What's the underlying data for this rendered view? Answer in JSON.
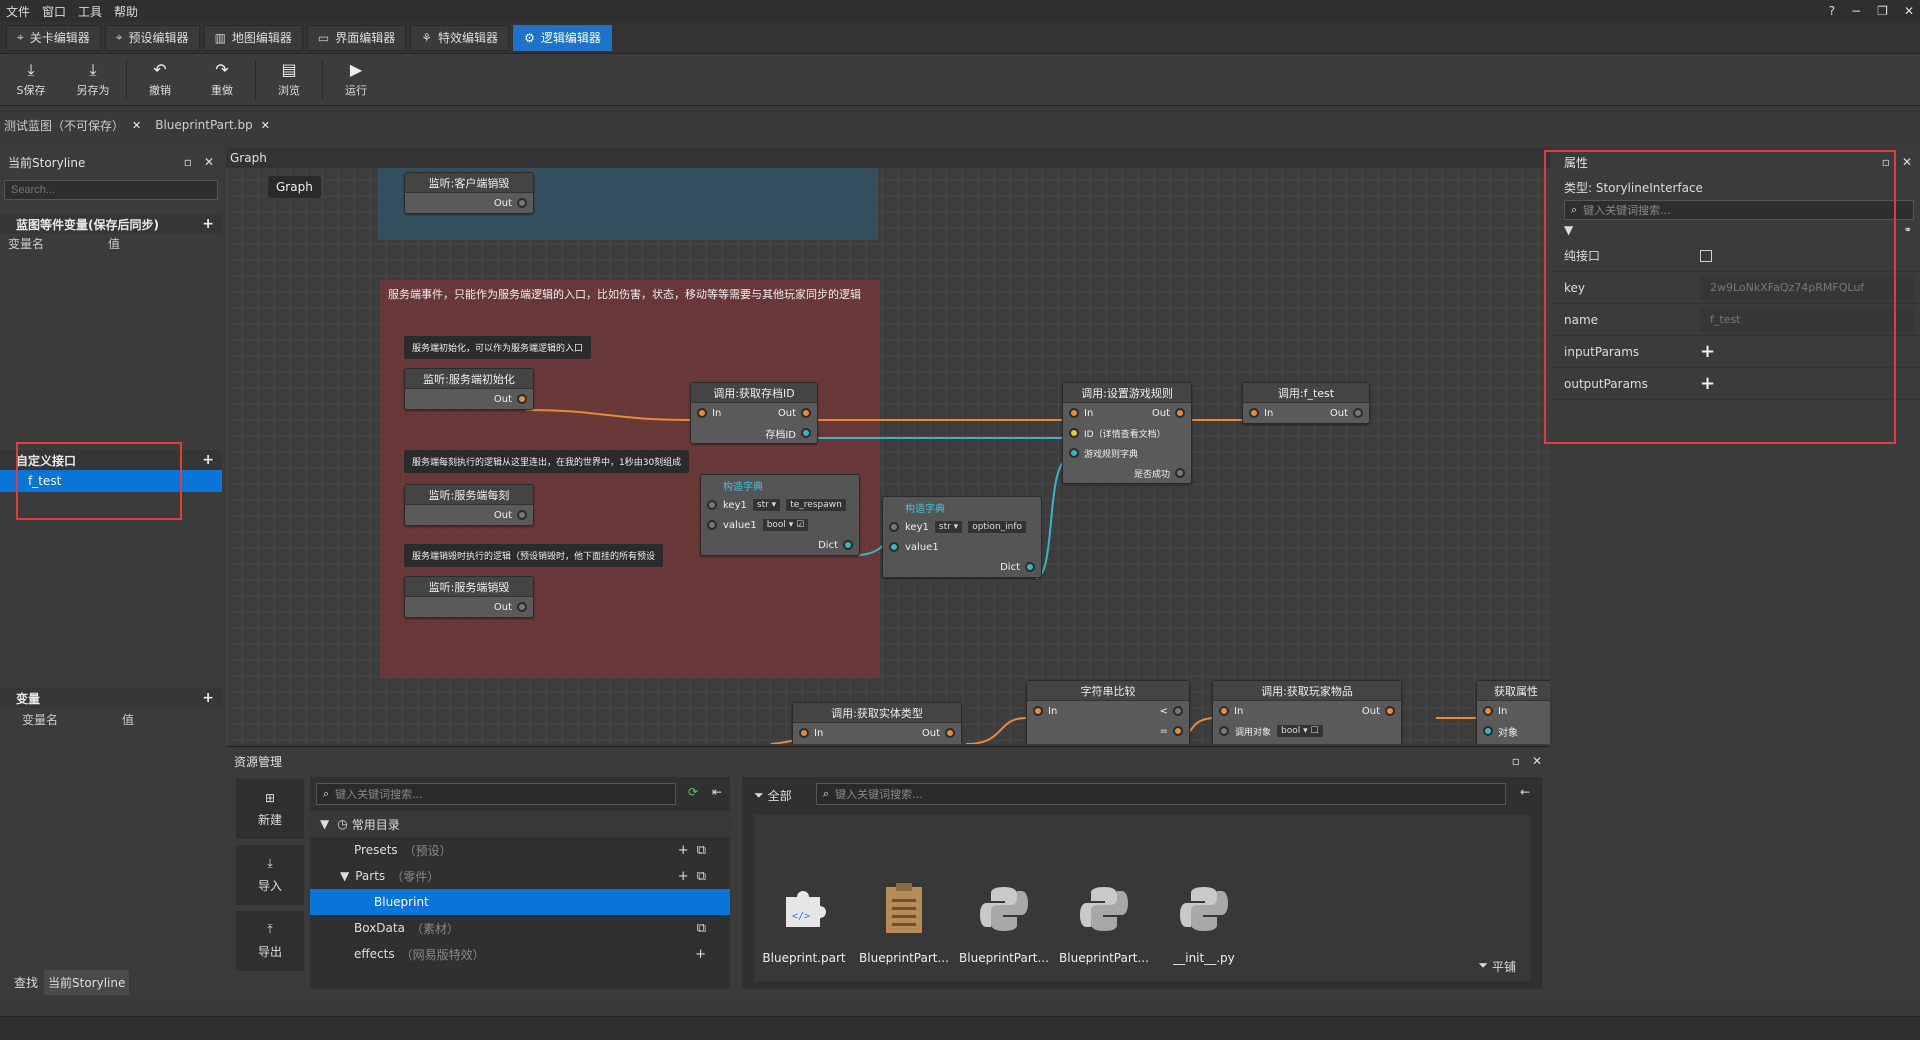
{
  "menubar": {
    "items": [
      "文件",
      "窗口",
      "工具",
      "帮助"
    ],
    "controls": [
      "?",
      "−",
      "❐",
      "✕"
    ]
  },
  "editor_tabs": [
    {
      "label": "关卡编辑器",
      "icon": "crosshair-icon"
    },
    {
      "label": "预设编辑器",
      "icon": "crosshair-icon"
    },
    {
      "label": "地图编辑器",
      "icon": "map-icon"
    },
    {
      "label": "界面编辑器",
      "icon": "window-icon"
    },
    {
      "label": "特效编辑器",
      "icon": "network-icon"
    },
    {
      "label": "逻辑编辑器",
      "icon": "gear-icon",
      "active": true
    }
  ],
  "toolbar": {
    "save": "S保存",
    "save_as": "另存为",
    "undo": "撤销",
    "redo": "重做",
    "browse": "浏览",
    "run": "运行"
  },
  "doc_tabs": [
    {
      "label": "测试蓝图（不可保存）"
    },
    {
      "label": "BlueprintPart.bp"
    }
  ],
  "left_panel": {
    "title": "当前Storyline",
    "search_placeholder": "Search...",
    "blueprint_vars": {
      "header": "蓝图等件变量(保存后同步)",
      "col_name": "变量名",
      "col_value": "值"
    },
    "custom_interface": {
      "header": "自定义接口",
      "items": [
        "f_test"
      ]
    },
    "variables": {
      "header": "变量",
      "col_name": "变量名",
      "col_value": "值"
    },
    "bottom_tabs": [
      "查找",
      "当前Storyline"
    ]
  },
  "graph": {
    "header": "Graph",
    "chip": "Graph",
    "comment_title": "服务端事件，只能作为服务端逻辑的入口，比如伤害，状态，移动等等需要与其他玩家同步的逻辑",
    "notes": [
      "服务端初始化，可以作为服务端逻辑的入口",
      "服务端每刻执行的逻辑从这里连出，在我的世界中，1秒由30刻组成",
      "服务端销毁时执行的逻辑（预设销毁时，他下面挂的所有预设"
    ],
    "nodes": {
      "client_destroy": {
        "title": "监听:客户端销毁",
        "out": "Out"
      },
      "server_init": {
        "title": "监听:服务端初始化",
        "out": "Out"
      },
      "server_tick": {
        "title": "监听:服务端每刻",
        "out": "Out"
      },
      "server_destroy": {
        "title": "监听:服务端销毁",
        "out": "Out"
      },
      "get_save_id": {
        "title": "调用:获取存档ID",
        "in": "In",
        "out": "Out",
        "save_id": "存档ID"
      },
      "set_game_rule": {
        "title": "调用:设置游戏规则",
        "in": "In",
        "out": "Out",
        "id": "ID（详情查看文档）",
        "rule_dict": "游戏规则字典",
        "success": "是否成功"
      },
      "call_f_test": {
        "title": "调用:f_test",
        "in": "In",
        "out": "Out"
      },
      "build_dict_1": {
        "title": "构造字典",
        "key": "key1",
        "key_type": "str",
        "key_value": "te_respawn",
        "value": "value1",
        "value_type": "bool",
        "dict": "Dict"
      },
      "build_dict_2": {
        "title": "构造字典",
        "key": "key1",
        "key_type": "str",
        "key_value": "option_info",
        "value": "value1",
        "dict": "Dict"
      },
      "string_compare": {
        "title": "字符串比较",
        "in": "In",
        "lt": "<",
        "eq": "="
      },
      "get_entity_type": {
        "title": "调用:获取实体类型",
        "in": "In",
        "out": "Out"
      },
      "get_player_item": {
        "title": "调用:获取玩家物品",
        "in": "In",
        "out": "Out",
        "call_obj": "调用对象",
        "type": "bool"
      },
      "get_attr": {
        "title": "获取属性",
        "in": "In",
        "obj": "对象"
      }
    }
  },
  "properties": {
    "title": "属性",
    "type_label": "类型: StorylineInterface",
    "search_placeholder": "键入关键词搜索...",
    "rows": {
      "pure": "纯接口",
      "key": "key",
      "key_value": "2w9LoNkXFaQz74pRMFQLuf",
      "name": "name",
      "name_value": "f_test",
      "input_params": "inputParams",
      "output_params": "outputParams"
    }
  },
  "resources": {
    "title": "资源管理",
    "side_buttons": [
      "新建",
      "导入",
      "导出"
    ],
    "search_placeholder": "键入关键词搜索...",
    "tree": [
      {
        "label": "常用目录",
        "sub": ""
      },
      {
        "label": "Presets",
        "sub": "（预设）"
      },
      {
        "label": "Parts",
        "sub": "（零件）"
      },
      {
        "label": "Blueprint",
        "sub": ""
      },
      {
        "label": "BoxData",
        "sub": "（素材）"
      },
      {
        "label": "effects",
        "sub": "（网易版特效）"
      }
    ],
    "filter_label": "全部",
    "files_search_placeholder": "键入关键词搜索...",
    "files": [
      "Blueprint.part",
      "BlueprintPart...",
      "BlueprintPart...",
      "BlueprintPart...",
      "__init__.py"
    ],
    "flat_label": "平铺"
  },
  "colors": {
    "accent": "#1e73c8",
    "selection": "#0a74d8",
    "exec_pin": "#e8893b",
    "data_pin": "#3bb3c3",
    "highlight_border": "#e23b3b"
  }
}
